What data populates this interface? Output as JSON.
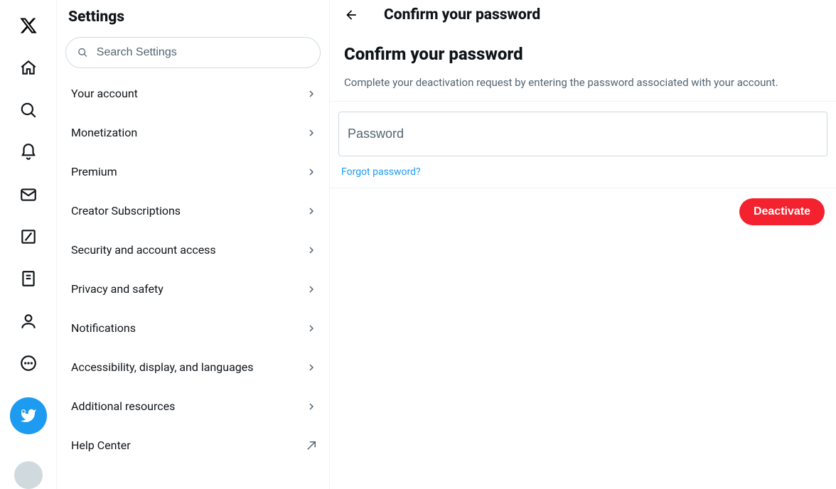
{
  "rail": {
    "items": [
      {
        "name": "x-logo-icon"
      },
      {
        "name": "home-icon"
      },
      {
        "name": "search-icon"
      },
      {
        "name": "notifications-icon"
      },
      {
        "name": "messages-icon"
      },
      {
        "name": "grok-icon"
      },
      {
        "name": "lists-icon"
      },
      {
        "name": "profile-icon"
      },
      {
        "name": "more-icon"
      }
    ],
    "compose_name": "compose-tweet-button",
    "avatar_name": "account-avatar"
  },
  "settings": {
    "title": "Settings",
    "search_placeholder": "Search Settings",
    "items": [
      {
        "label": "Your account",
        "link_type": "internal"
      },
      {
        "label": "Monetization",
        "link_type": "internal"
      },
      {
        "label": "Premium",
        "link_type": "internal"
      },
      {
        "label": "Creator Subscriptions",
        "link_type": "internal"
      },
      {
        "label": "Security and account access",
        "link_type": "internal"
      },
      {
        "label": "Privacy and safety",
        "link_type": "internal"
      },
      {
        "label": "Notifications",
        "link_type": "internal"
      },
      {
        "label": "Accessibility, display, and languages",
        "link_type": "internal"
      },
      {
        "label": "Additional resources",
        "link_type": "internal"
      },
      {
        "label": "Help Center",
        "link_type": "external"
      }
    ]
  },
  "detail": {
    "header_title": "Confirm your password",
    "section_title": "Confirm your password",
    "section_desc": "Complete your deactivation request by entering the password associated with your account.",
    "password_placeholder": "Password",
    "password_value": "",
    "forgot_label": "Forgot password?",
    "action_label": "Deactivate"
  },
  "colors": {
    "accent": "#1d9bf0",
    "danger": "#f4212e",
    "text": "#0f1419",
    "muted": "#536471",
    "border": "#eff3f4"
  }
}
